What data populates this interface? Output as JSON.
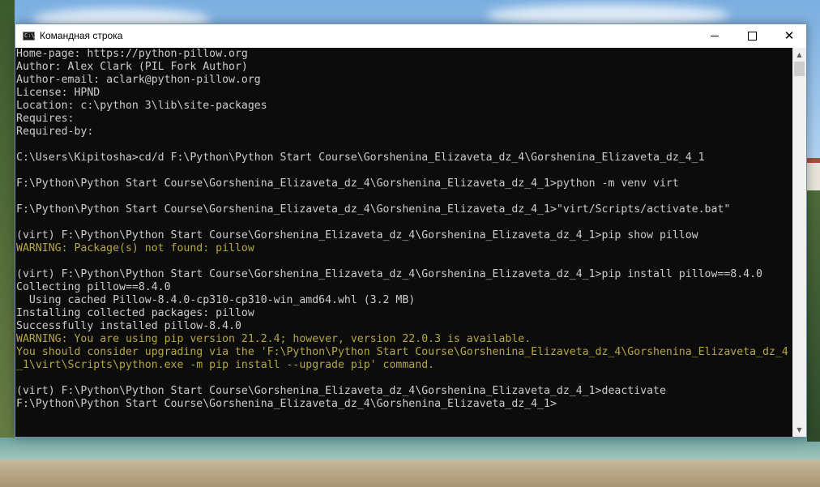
{
  "window": {
    "title": "Командная строка",
    "app_icon_text": "C:\\"
  },
  "console": {
    "lines": [
      {
        "text": "Home-page: https://python-pillow.org",
        "warn": false
      },
      {
        "text": "Author: Alex Clark (PIL Fork Author)",
        "warn": false
      },
      {
        "text": "Author-email: aclark@python-pillow.org",
        "warn": false
      },
      {
        "text": "License: HPND",
        "warn": false
      },
      {
        "text": "Location: c:\\python 3\\lib\\site-packages",
        "warn": false
      },
      {
        "text": "Requires:",
        "warn": false
      },
      {
        "text": "Required-by:",
        "warn": false
      },
      {
        "text": "",
        "warn": false
      },
      {
        "text": "C:\\Users\\Kipitosha>cd/d F:\\Python\\Python Start Course\\Gorshenina_Elizaveta_dz_4\\Gorshenina_Elizaveta_dz_4_1",
        "warn": false
      },
      {
        "text": "",
        "warn": false
      },
      {
        "text": "F:\\Python\\Python Start Course\\Gorshenina_Elizaveta_dz_4\\Gorshenina_Elizaveta_dz_4_1>python -m venv virt",
        "warn": false
      },
      {
        "text": "",
        "warn": false
      },
      {
        "text": "F:\\Python\\Python Start Course\\Gorshenina_Elizaveta_dz_4\\Gorshenina_Elizaveta_dz_4_1>\"virt/Scripts/activate.bat\"",
        "warn": false
      },
      {
        "text": "",
        "warn": false
      },
      {
        "text": "(virt) F:\\Python\\Python Start Course\\Gorshenina_Elizaveta_dz_4\\Gorshenina_Elizaveta_dz_4_1>pip show pillow",
        "warn": false
      },
      {
        "text": "WARNING: Package(s) not found: pillow",
        "warn": true
      },
      {
        "text": "",
        "warn": false
      },
      {
        "text": "(virt) F:\\Python\\Python Start Course\\Gorshenina_Elizaveta_dz_4\\Gorshenina_Elizaveta_dz_4_1>pip install pillow==8.4.0",
        "warn": false
      },
      {
        "text": "Collecting pillow==8.4.0",
        "warn": false
      },
      {
        "text": "  Using cached Pillow-8.4.0-cp310-cp310-win_amd64.whl (3.2 MB)",
        "warn": false
      },
      {
        "text": "Installing collected packages: pillow",
        "warn": false
      },
      {
        "text": "Successfully installed pillow-8.4.0",
        "warn": false
      },
      {
        "text": "WARNING: You are using pip version 21.2.4; however, version 22.0.3 is available.",
        "warn": true
      },
      {
        "text": "You should consider upgrading via the 'F:\\Python\\Python Start Course\\Gorshenina_Elizaveta_dz_4\\Gorshenina_Elizaveta_dz_4",
        "warn": true
      },
      {
        "text": "_1\\virt\\Scripts\\python.exe -m pip install --upgrade pip' command.",
        "warn": true
      },
      {
        "text": "",
        "warn": false
      },
      {
        "text": "(virt) F:\\Python\\Python Start Course\\Gorshenina_Elizaveta_dz_4\\Gorshenina_Elizaveta_dz_4_1>deactivate",
        "warn": false
      },
      {
        "text": "F:\\Python\\Python Start Course\\Gorshenina_Elizaveta_dz_4\\Gorshenina_Elizaveta_dz_4_1>",
        "warn": false
      }
    ]
  },
  "colors": {
    "console_bg": "#0c0c0c",
    "console_text": "#cccccc",
    "warning_text": "#b5a642"
  },
  "icons": {
    "minimize": "minimize-icon",
    "maximize": "maximize-icon",
    "close": "close-icon",
    "scroll_up": "chevron-up-icon",
    "scroll_down": "chevron-down-icon"
  }
}
